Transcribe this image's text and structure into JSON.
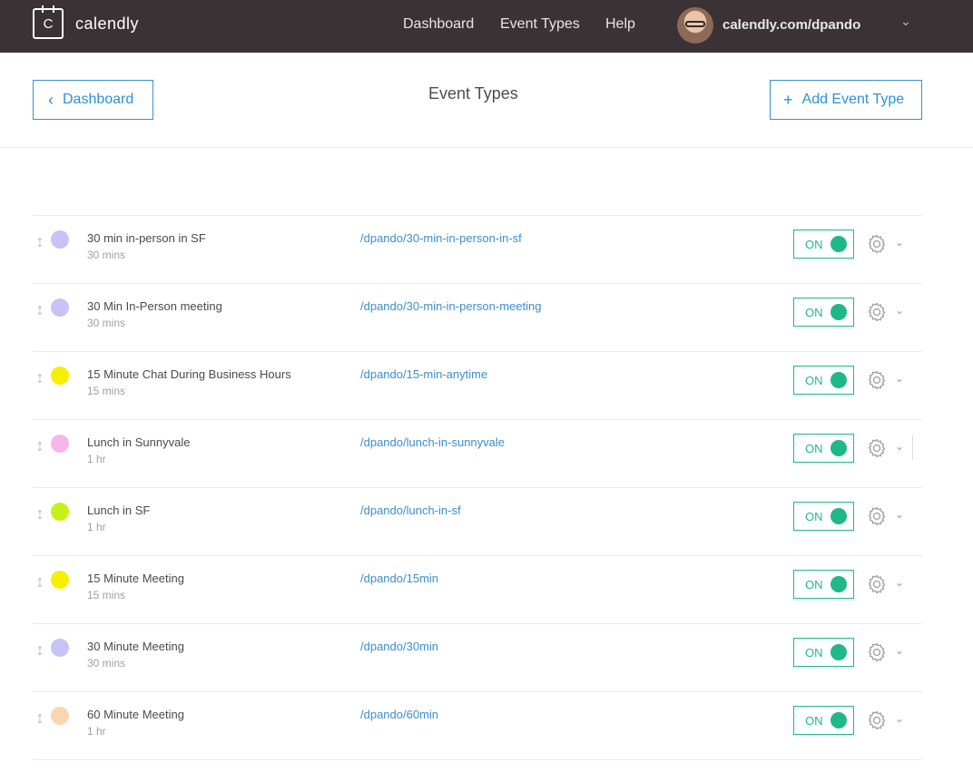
{
  "app": {
    "logo_letter": "C",
    "logo_text": "calendly"
  },
  "nav": {
    "links": [
      "Dashboard",
      "Event Types",
      "Help"
    ],
    "user_url": "calendly.com/dpando",
    "caret": "⌄"
  },
  "header": {
    "back_label": "Dashboard",
    "back_icon": "‹",
    "title": "Event Types",
    "add_label": "Add Event Type",
    "add_icon": "+"
  },
  "toggle_on_label": "ON",
  "colors": {
    "accent": "#3a8fd0",
    "toggle_green": "#1fb889",
    "nav_bg": "#3a3234"
  },
  "events": [
    {
      "name": "30 min in-person in SF",
      "duration": "30 mins",
      "link": "/dpando/30-min-in-person-in-sf",
      "color": "#c8c3f5"
    },
    {
      "name": "30 Min In-Person meeting",
      "duration": "30 mins",
      "link": "/dpando/30-min-in-person-meeting",
      "color": "#c8c3f5"
    },
    {
      "name": "15 Minute Chat During Business Hours",
      "duration": "15 mins",
      "link": "/dpando/15-min-anytime",
      "color": "#f6f000"
    },
    {
      "name": "Lunch in Sunnyvale",
      "duration": "1 hr",
      "link": "/dpando/lunch-in-sunnyvale",
      "color": "#f8b5ea"
    },
    {
      "name": "Lunch in SF",
      "duration": "1 hr",
      "link": "/dpando/lunch-in-sf",
      "color": "#c6f21a"
    },
    {
      "name": "15 Minute Meeting",
      "duration": "15 mins",
      "link": "/dpando/15min",
      "color": "#f6f000"
    },
    {
      "name": "30 Minute Meeting",
      "duration": "30 mins",
      "link": "/dpando/30min",
      "color": "#c8c3f5"
    },
    {
      "name": "60 Minute Meeting",
      "duration": "1 hr",
      "link": "/dpando/60min",
      "color": "#fcd5b1"
    }
  ]
}
